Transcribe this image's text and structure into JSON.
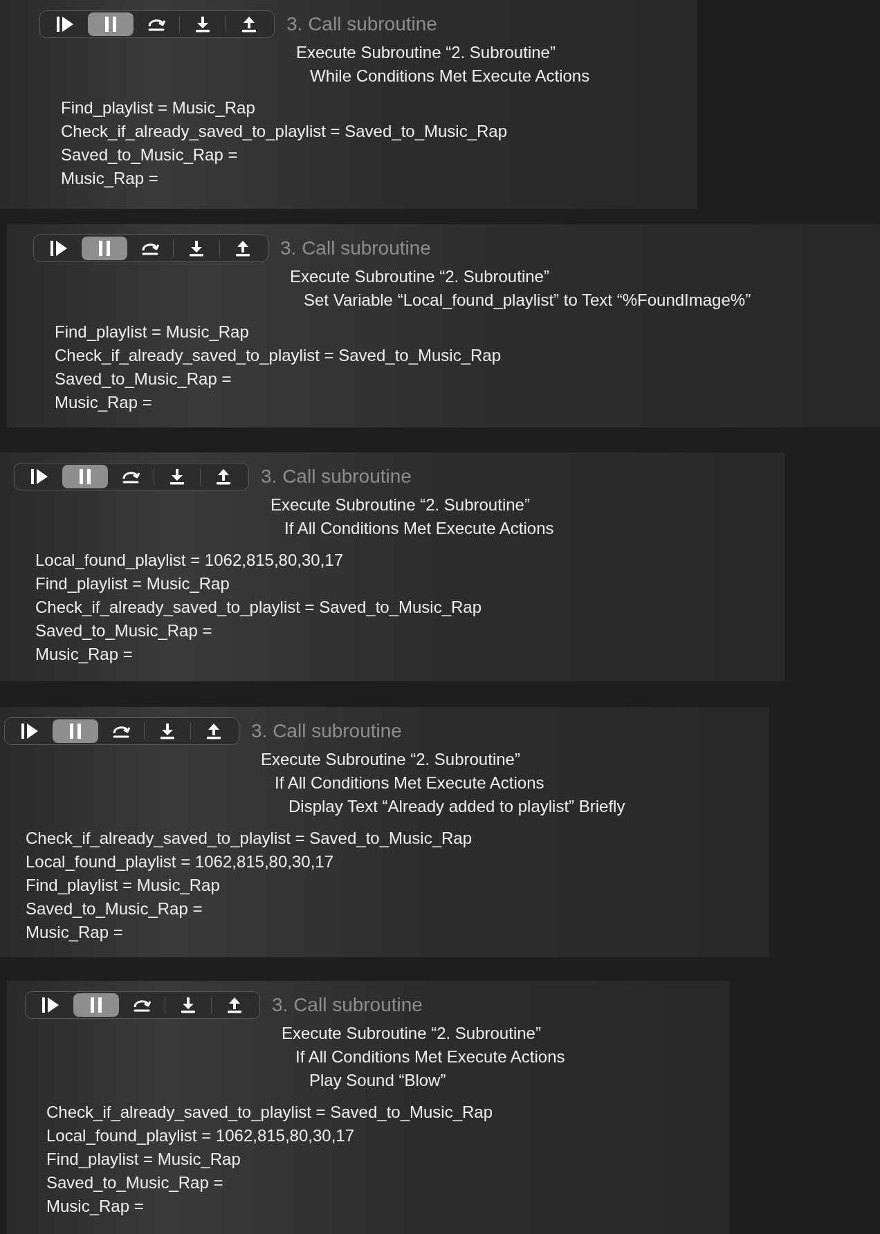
{
  "panels": [
    {
      "toolbar": [
        {
          "kind": "continue",
          "selected": false
        },
        {
          "kind": "pause",
          "selected": true
        },
        {
          "kind": "step_over",
          "selected": false
        },
        {
          "kind": "step_in",
          "selected": false
        },
        {
          "kind": "step_out",
          "selected": false
        }
      ],
      "title": "3. Call subroutine",
      "actions": [
        {
          "text": "Execute Subroutine “2. Subroutine”",
          "children": [
            {
              "text": "While Conditions Met Execute Actions"
            }
          ]
        }
      ],
      "variables": [
        "Find_playlist = Music_Rap",
        "Check_if_already_saved_to_playlist = Saved_to_Music_Rap",
        "Saved_to_Music_Rap =",
        "Music_Rap ="
      ]
    },
    {
      "toolbar": [
        {
          "kind": "continue",
          "selected": false
        },
        {
          "kind": "pause",
          "selected": true
        },
        {
          "kind": "step_over",
          "selected": false
        },
        {
          "kind": "step_in",
          "selected": false
        },
        {
          "kind": "step_out",
          "selected": false
        }
      ],
      "title": "3. Call subroutine",
      "actions": [
        {
          "text": "Execute Subroutine “2. Subroutine”",
          "children": [
            {
              "text": "Set Variable “Local_found_playlist” to Text “%FoundImage%”"
            }
          ]
        }
      ],
      "variables": [
        "Find_playlist = Music_Rap",
        "Check_if_already_saved_to_playlist = Saved_to_Music_Rap",
        "Saved_to_Music_Rap =",
        "Music_Rap ="
      ]
    },
    {
      "toolbar": [
        {
          "kind": "continue",
          "selected": false
        },
        {
          "kind": "pause",
          "selected": true
        },
        {
          "kind": "step_over",
          "selected": false
        },
        {
          "kind": "step_in",
          "selected": false
        },
        {
          "kind": "step_out",
          "selected": false
        }
      ],
      "title": "3. Call subroutine",
      "actions": [
        {
          "text": "Execute Subroutine “2. Subroutine”",
          "children": [
            {
              "text": "If All Conditions Met Execute Actions"
            }
          ]
        }
      ],
      "variables": [
        "Local_found_playlist = 1062,815,80,30,17",
        "Find_playlist = Music_Rap",
        "Check_if_already_saved_to_playlist = Saved_to_Music_Rap",
        "Saved_to_Music_Rap =",
        "Music_Rap ="
      ]
    },
    {
      "toolbar": [
        {
          "kind": "continue",
          "selected": false
        },
        {
          "kind": "pause",
          "selected": true
        },
        {
          "kind": "step_over",
          "selected": false
        },
        {
          "kind": "step_in",
          "selected": false
        },
        {
          "kind": "step_out",
          "selected": false
        }
      ],
      "title": "3. Call subroutine",
      "actions": [
        {
          "text": "Execute Subroutine “2. Subroutine”",
          "children": [
            {
              "text": "If All Conditions Met Execute Actions",
              "children": [
                {
                  "text": "Display Text “Already added to playlist” Briefly"
                }
              ]
            }
          ]
        }
      ],
      "variables": [
        "Check_if_already_saved_to_playlist = Saved_to_Music_Rap",
        "Local_found_playlist = 1062,815,80,30,17",
        "Find_playlist = Music_Rap",
        "Saved_to_Music_Rap =",
        "Music_Rap ="
      ]
    },
    {
      "toolbar": [
        {
          "kind": "continue",
          "selected": false
        },
        {
          "kind": "pause",
          "selected": true
        },
        {
          "kind": "step_over",
          "selected": false
        },
        {
          "kind": "step_in",
          "selected": false
        },
        {
          "kind": "step_out",
          "selected": false
        }
      ],
      "title": "3. Call subroutine",
      "actions": [
        {
          "text": "Execute Subroutine “2. Subroutine”",
          "children": [
            {
              "text": "If All Conditions Met Execute Actions",
              "children": [
                {
                  "text": "Play Sound “Blow”"
                }
              ]
            }
          ]
        }
      ],
      "variables": [
        "Check_if_already_saved_to_playlist = Saved_to_Music_Rap",
        "Local_found_playlist = 1062,815,80,30,17",
        "Find_playlist = Music_Rap",
        "Saved_to_Music_Rap =",
        "Music_Rap ="
      ]
    }
  ]
}
